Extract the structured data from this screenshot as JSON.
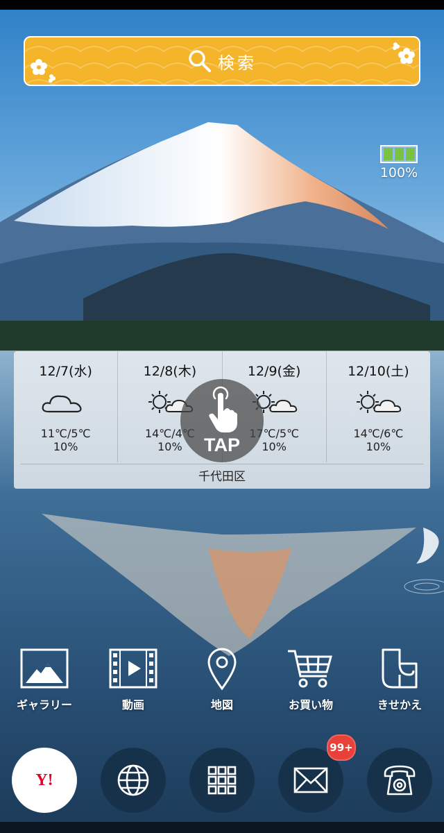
{
  "search": {
    "label": "検索"
  },
  "battery": {
    "percent": "100%",
    "level": 1.0,
    "color": "#7bc242"
  },
  "weather": {
    "days": [
      {
        "date": "12/7(水)",
        "icon": "cloud-icon",
        "temp": "11℃/5℃",
        "rain": "10%"
      },
      {
        "date": "12/8(木)",
        "icon": "sun-cloud-icon",
        "temp": "14℃/4℃",
        "rain": "10%"
      },
      {
        "date": "12/9(金)",
        "icon": "sun-cloud-icon",
        "temp": "17℃/5℃",
        "rain": "10%"
      },
      {
        "date": "12/10(土)",
        "icon": "sun-cloud-icon",
        "temp": "14℃/6℃",
        "rain": "10%"
      }
    ],
    "location": "千代田区",
    "tap_label": "TAP"
  },
  "apps": [
    {
      "label": "ギャラリー",
      "icon": "gallery-icon"
    },
    {
      "label": "動画",
      "icon": "video-icon"
    },
    {
      "label": "地図",
      "icon": "map-pin-icon"
    },
    {
      "label": "お買い物",
      "icon": "shopping-cart-icon"
    },
    {
      "label": "きせかえ",
      "icon": "theme-icon"
    }
  ],
  "dock": {
    "yahoo_logo": "Y!",
    "mail_badge": "99+",
    "items": [
      "yahoo-icon",
      "globe-icon",
      "app-grid-icon",
      "mail-icon",
      "phone-icon"
    ]
  },
  "colors": {
    "search_bar": "#f5b52a",
    "badge": "#e8413a",
    "yahoo_red": "#e60028"
  }
}
